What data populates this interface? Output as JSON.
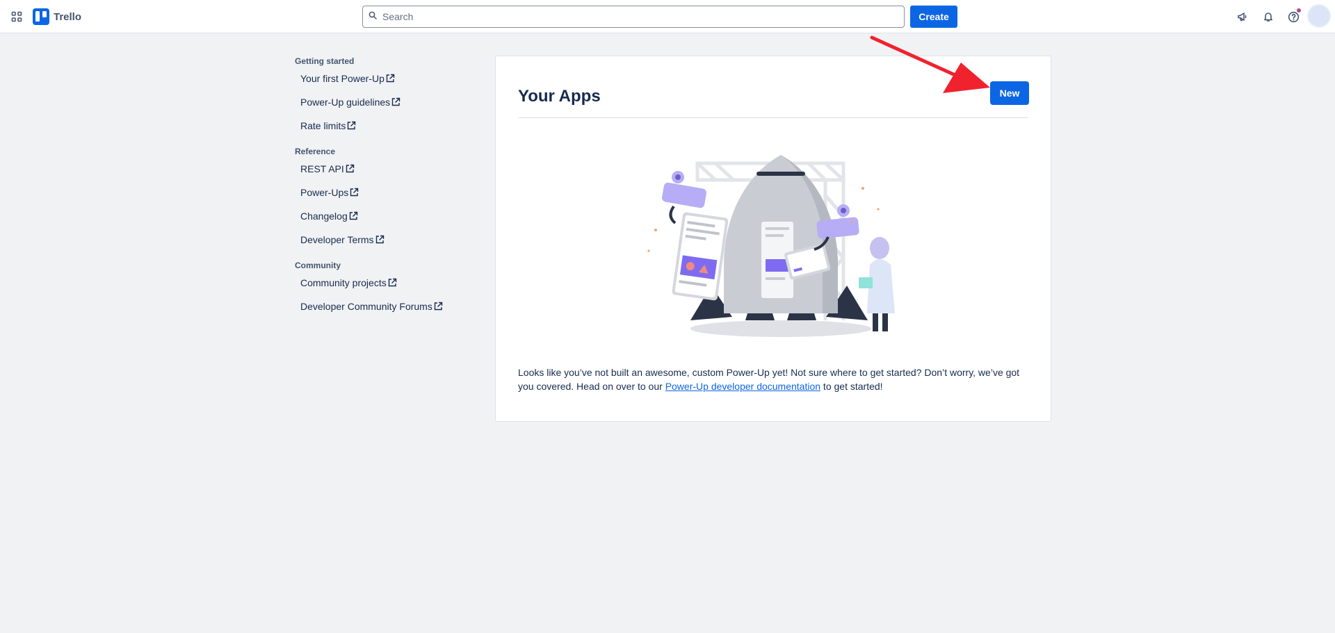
{
  "header": {
    "app_name": "Trello",
    "search_placeholder": "Search",
    "create_label": "Create",
    "icons": [
      "apps-grid-icon",
      "megaphone-icon",
      "bell-icon",
      "help-icon"
    ]
  },
  "sidebar": {
    "sections": [
      {
        "title": "Getting started",
        "items": [
          "Your first Power-Up",
          "Power-Up guidelines",
          "Rate limits"
        ]
      },
      {
        "title": "Reference",
        "items": [
          "REST API",
          "Power-Ups",
          "Changelog",
          "Developer Terms"
        ]
      },
      {
        "title": "Community",
        "items": [
          "Community projects",
          "Developer Community Forums"
        ]
      }
    ]
  },
  "main": {
    "title": "Your Apps",
    "new_label": "New",
    "empty_text_before": "Looks like you’ve not built an awesome, custom Power-Up yet! Not sure where to get started? Don’t worry, we’ve got you covered. Head on over to our ",
    "empty_link": "Power-Up developer documentation",
    "empty_text_after": " to get started!"
  },
  "colors": {
    "brand_blue": "#0c66e4",
    "page_bg": "#f1f2f4",
    "annotation_red": "#f0222e"
  }
}
